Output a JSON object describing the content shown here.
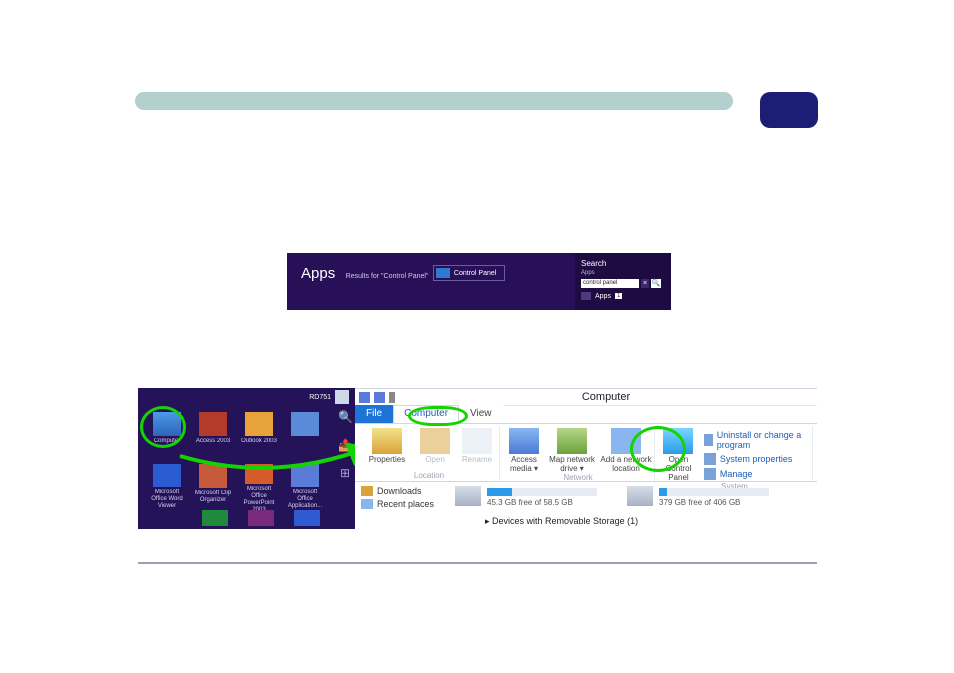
{
  "header": {
    "bar": "",
    "badge": ""
  },
  "apps": {
    "title": "Apps",
    "subtitle": "Results for \"Control Panel\"",
    "result_label": "Control Panel",
    "search_header": "Search",
    "search_category": "Apps",
    "search_value": "control panel",
    "clear": "×",
    "go": "🔍",
    "filter_label": "Apps",
    "filter_count": "1"
  },
  "start": {
    "user": "RD751",
    "tiles": [
      {
        "label": "Computer",
        "kind": "computer"
      },
      {
        "label": "Access 2003",
        "kind": "access"
      },
      {
        "label": "Outlook 2003",
        "kind": "outlook"
      },
      {
        "label": "",
        "kind": "pbk"
      },
      {
        "label": "Microsoft Office Word Viewer",
        "kind": "word"
      },
      {
        "label": "Microsoft Clip Organizer",
        "kind": "org"
      },
      {
        "label": "Microsoft Office PowerPoint 2003",
        "kind": "ppt"
      },
      {
        "label": "Microsoft Office Application...",
        "kind": "apps"
      }
    ],
    "charms": [
      "🔍",
      "📤",
      "⊞"
    ]
  },
  "explorer": {
    "title": "Computer",
    "tabs": {
      "file": "File",
      "computer": "Computer",
      "view": "View"
    },
    "ribbon": {
      "location": {
        "properties": "Properties",
        "open": "Open",
        "rename": "Rename",
        "group": "Location"
      },
      "network": {
        "media": "Access media ▾",
        "map": "Map network drive ▾",
        "addloc": "Add a network location",
        "group": "Network"
      },
      "system": {
        "cpanel": "Open Control Panel",
        "uninstall": "Uninstall or change a program",
        "sysprops": "System properties",
        "manage": "Manage",
        "group": "System"
      }
    },
    "nav": {
      "downloads": "Downloads",
      "recent": "Recent places"
    },
    "drives": [
      {
        "free": "45.3 GB free of 58.5 GB",
        "pct": 23
      },
      {
        "free": "379 GB free of 406 GB",
        "pct": 7
      }
    ],
    "section": "▸ Devices with Removable Storage (1)"
  }
}
